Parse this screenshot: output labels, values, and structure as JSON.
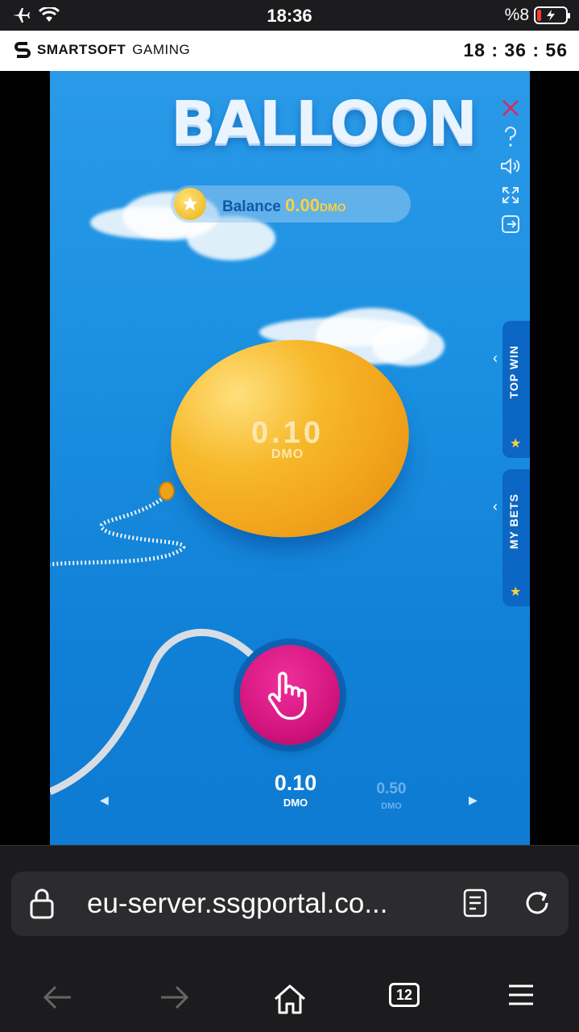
{
  "status_bar": {
    "time": "18:36",
    "battery": "%8"
  },
  "provider": {
    "brand_bold": "SMARTSOFT",
    "brand_light": "GAMING",
    "clock": "18 : 36 : 56"
  },
  "game": {
    "title": "BALLOON",
    "balance": {
      "label": "Balance",
      "amount": "0.00",
      "unit": "DMO"
    },
    "side_tabs": [
      {
        "label": "TOP WIN"
      },
      {
        "label": "MY BETS"
      }
    ],
    "balloon": {
      "value": "0.10",
      "unit": "DMO"
    },
    "bets": [
      {
        "value": "0.10",
        "unit": "DMO",
        "selected": true
      },
      {
        "value": "0.50",
        "unit": "DMO",
        "selected": false
      }
    ],
    "controls": [
      "close-icon",
      "help-icon",
      "sound-icon",
      "fullscreen-icon",
      "exit-icon"
    ],
    "colors": {
      "sky": "#1a8fe0",
      "balloon": "#f7b92c",
      "pump": "#d4147f",
      "accent": "#ffd23a"
    }
  },
  "browser": {
    "url": "eu-server.ssgportal.co...",
    "tab_count": "12"
  }
}
